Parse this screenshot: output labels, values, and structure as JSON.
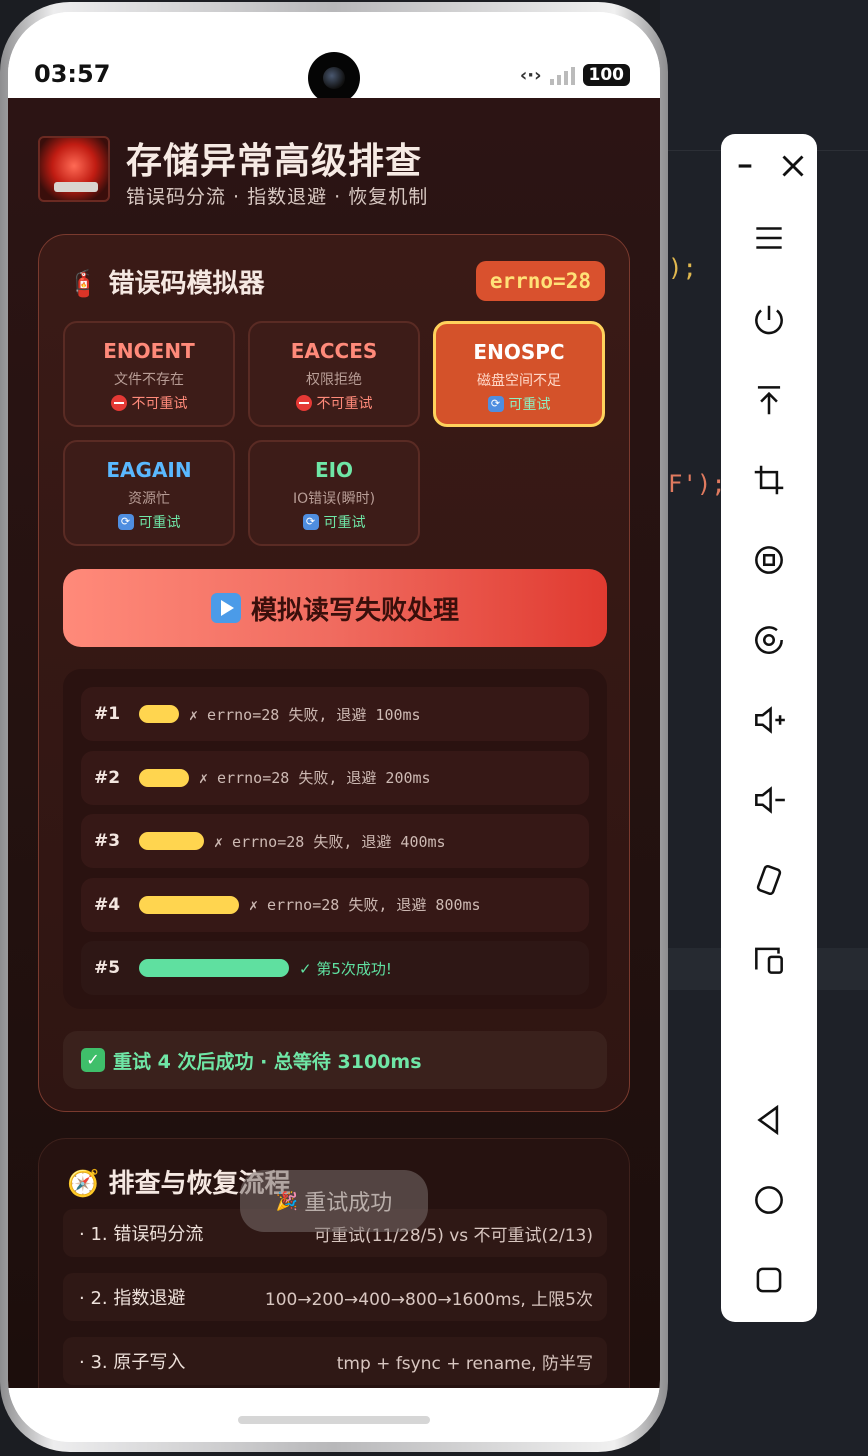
{
  "status_bar": {
    "time": "03:57",
    "battery": "100"
  },
  "header": {
    "title": "存储异常高级排查",
    "subtitle": "错误码分流 · 指数退避 · 恢复机制"
  },
  "simulator": {
    "icon": "fire-extinguisher-icon",
    "title": "错误码模拟器",
    "errno_badge": "errno=28",
    "codes": [
      {
        "code": "ENOENT",
        "desc": "文件不存在",
        "tag": "不可重试",
        "color": "#ff8a7a",
        "tag_color": "#ff8a7a"
      },
      {
        "code": "EACCES",
        "desc": "权限拒绝",
        "tag": "不可重试",
        "color": "#ff8a7a",
        "tag_color": "#ff8a7a"
      },
      {
        "code": "ENOSPC",
        "desc": "磁盘空间不足",
        "tag": "可重试",
        "color": "#ffffff",
        "tag_color": "#8ff0c0",
        "selected": true
      },
      {
        "code": "EAGAIN",
        "desc": "资源忙",
        "tag": "可重试",
        "color": "#5ab8ff",
        "tag_color": "#6fe6a6"
      },
      {
        "code": "EIO",
        "desc": "IO错误(瞬时)",
        "tag": "可重试",
        "color": "#6fe6a6",
        "tag_color": "#6fe6a6"
      }
    ],
    "run_button": "模拟读写失败处理",
    "log": [
      {
        "num": "#1",
        "text": "✗ errno=28 失败, 退避 100ms",
        "fill": 0.08
      },
      {
        "num": "#2",
        "text": "✗ errno=28 失败, 退避 200ms",
        "fill": 0.1
      },
      {
        "num": "#3",
        "text": "✗ errno=28 失败, 退避 400ms",
        "fill": 0.13
      },
      {
        "num": "#4",
        "text": "✗ errno=28 失败, 退避 800ms",
        "fill": 0.2
      },
      {
        "num": "#5",
        "text": "✓ 第5次成功!",
        "fill": 0.3,
        "ok": true
      }
    ],
    "summary": "重试 4 次后成功 · 总等待 3100ms"
  },
  "flow": {
    "icon": "compass-icon",
    "title": "排查与恢复流程",
    "rows": [
      {
        "name": "· 1. 错误码分流",
        "value": "可重试(11/28/5) vs 不可重试(2/13)"
      },
      {
        "name": "· 2. 指数退避",
        "value": "100→200→400→800→1600ms, 上限5次"
      },
      {
        "name": "· 3. 原子写入",
        "value": "tmp + fsync + rename, 防半写"
      }
    ]
  },
  "toast": {
    "text": "重试成功",
    "icon": "party-icon"
  },
  "background_code": {
    "line1": ");",
    "line2": "F');"
  },
  "toolbar": {
    "items": [
      "minimize-icon",
      "close-icon",
      "menu-icon",
      "power-icon",
      "pin-top-icon",
      "crop-icon",
      "rotate-lock-icon",
      "screenshot-icon",
      "volume-up-icon",
      "volume-down-icon",
      "rotate-device-icon",
      "devices-icon",
      "back-icon",
      "home-icon",
      "recents-icon"
    ]
  }
}
